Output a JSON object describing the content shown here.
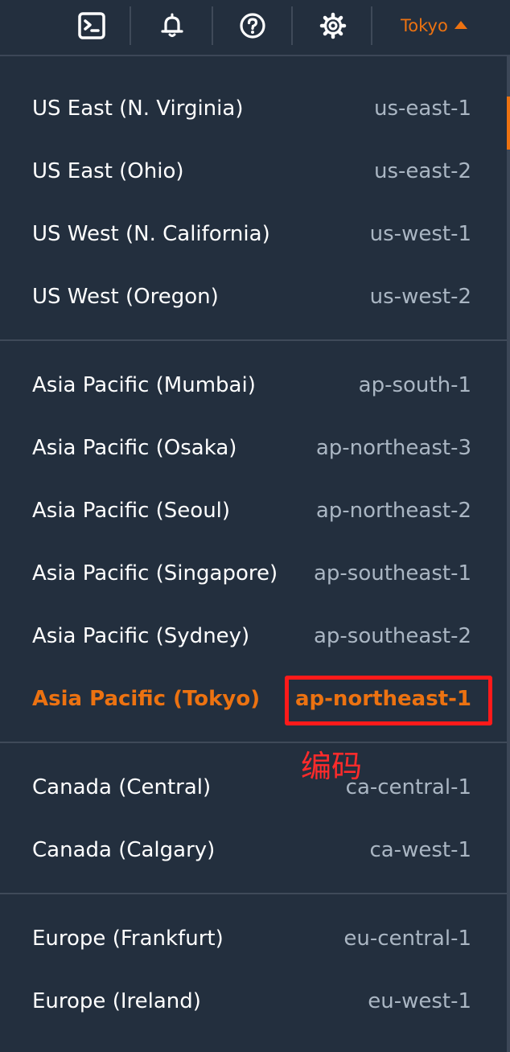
{
  "topbar": {
    "icons": [
      "terminal-icon",
      "bell-icon",
      "help-icon",
      "gear-icon"
    ],
    "region_label": "Tokyo"
  },
  "region_groups": [
    {
      "items": [
        {
          "name": "US East (N. Virginia)",
          "code": "us-east-1"
        },
        {
          "name": "US East (Ohio)",
          "code": "us-east-2"
        },
        {
          "name": "US West (N. California)",
          "code": "us-west-1"
        },
        {
          "name": "US West (Oregon)",
          "code": "us-west-2"
        }
      ]
    },
    {
      "items": [
        {
          "name": "Asia Pacific (Mumbai)",
          "code": "ap-south-1"
        },
        {
          "name": "Asia Pacific (Osaka)",
          "code": "ap-northeast-3"
        },
        {
          "name": "Asia Pacific (Seoul)",
          "code": "ap-northeast-2"
        },
        {
          "name": "Asia Pacific (Singapore)",
          "code": "ap-southeast-1"
        },
        {
          "name": "Asia Pacific (Sydney)",
          "code": "ap-southeast-2"
        },
        {
          "name": "Asia Pacific (Tokyo)",
          "code": "ap-northeast-1",
          "selected": true
        }
      ]
    },
    {
      "items": [
        {
          "name": "Canada (Central)",
          "code": "ca-central-1"
        },
        {
          "name": "Canada (Calgary)",
          "code": "ca-west-1"
        }
      ]
    },
    {
      "items": [
        {
          "name": "Europe (Frankfurt)",
          "code": "eu-central-1"
        },
        {
          "name": "Europe (Ireland)",
          "code": "eu-west-1"
        }
      ]
    }
  ],
  "annotation": {
    "text": "编码"
  },
  "colors": {
    "background": "#232f3e",
    "accent": "#ec7211",
    "annotation": "#ff1a1a"
  }
}
